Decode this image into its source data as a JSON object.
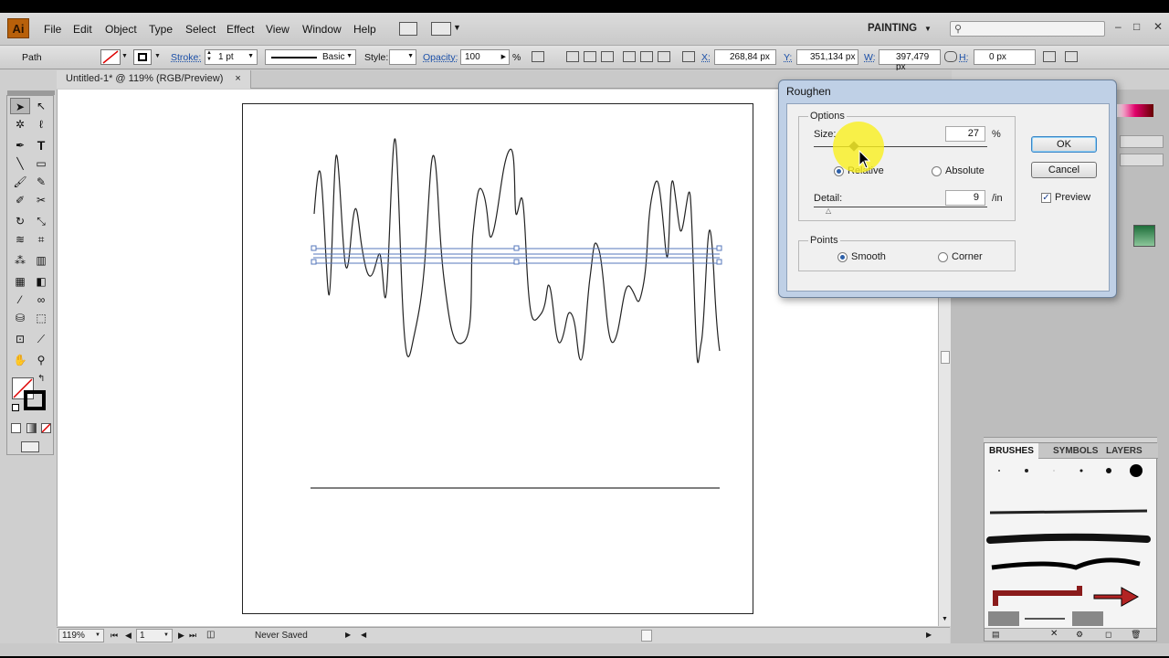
{
  "app": {
    "logo": "Ai",
    "workspace": "PAINTING"
  },
  "menu": {
    "items": [
      "File",
      "Edit",
      "Object",
      "Type",
      "Select",
      "Effect",
      "View",
      "Window",
      "Help"
    ]
  },
  "control_bar": {
    "selection_type": "Path",
    "stroke_label": "Stroke:",
    "stroke_weight": "1 pt",
    "brush_name": "Basic",
    "style_label": "Style:",
    "opacity_label": "Opacity:",
    "opacity_value": "100",
    "percent": "%",
    "x_label": "X:",
    "x_value": "268,84 px",
    "y_label": "Y:",
    "y_value": "351,134 px",
    "w_label": "W:",
    "w_value": "397,479 px",
    "h_label": "H:",
    "h_value": "0 px"
  },
  "document": {
    "tab": "Untitled-1* @ 119% (RGB/Preview)",
    "close": "×"
  },
  "status": {
    "zoom": "119%",
    "artboard": "1",
    "save_state": "Never Saved"
  },
  "panels": {
    "tabs": [
      "BRUSHES",
      "SYMBOLS",
      "LAYERS"
    ]
  },
  "dialog": {
    "title": "Roughen",
    "options_legend": "Options",
    "size_label": "Size:",
    "size_value": "27",
    "size_unit": "%",
    "relative": "Relative",
    "absolute": "Absolute",
    "detail_label": "Detail:",
    "detail_value": "9",
    "detail_unit": "/in",
    "points_legend": "Points",
    "smooth": "Smooth",
    "corner": "Corner",
    "ok": "OK",
    "cancel": "Cancel",
    "preview": "Preview"
  },
  "colors": {
    "accent": "#3a84c6",
    "dialog_frame": "#bfd0e6",
    "logo": "#b8600a"
  }
}
